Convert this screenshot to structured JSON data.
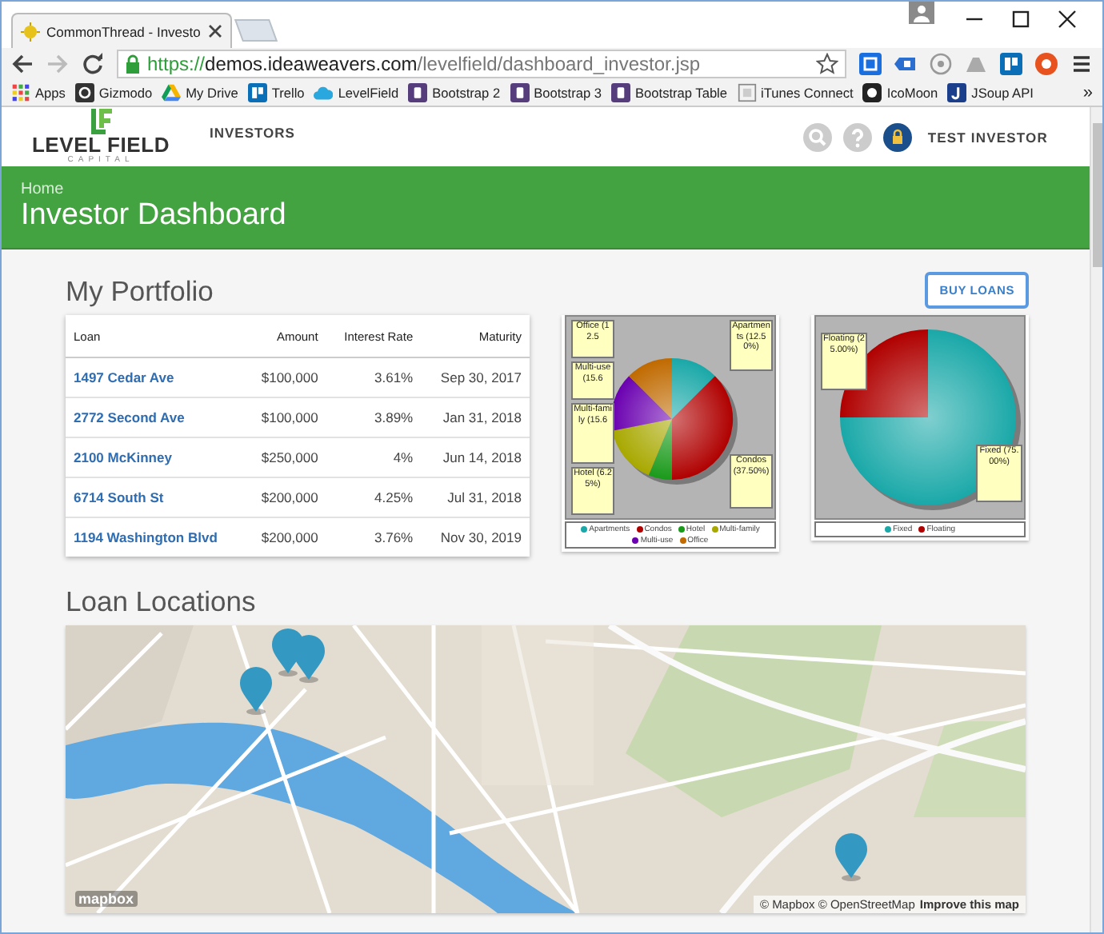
{
  "browser": {
    "tab_title": "CommonThread - Investo",
    "url": {
      "scheme": "https://",
      "host": "demos.ideaweavers.com",
      "path": "/levelfield/dashboard_investor.jsp"
    },
    "bookmarks": [
      {
        "label": "Apps"
      },
      {
        "label": "Gizmodo"
      },
      {
        "label": "My Drive"
      },
      {
        "label": "Trello"
      },
      {
        "label": "LevelField"
      },
      {
        "label": "Bootstrap 2"
      },
      {
        "label": "Bootstrap 3"
      },
      {
        "label": "Bootstrap Table"
      },
      {
        "label": "iTunes Connect"
      },
      {
        "label": "IcoMoon"
      },
      {
        "label": "JSoup API"
      }
    ],
    "more": "»"
  },
  "header": {
    "logo": {
      "name": "LEVEL FIELD",
      "sub": "CAPITAL"
    },
    "nav": [
      {
        "label": "INVESTORS"
      }
    ],
    "user": "TEST INVESTOR"
  },
  "banner": {
    "breadcrumb": "Home",
    "title": "Investor Dashboard"
  },
  "portfolio": {
    "title": "My Portfolio",
    "button": "BUY LOANS",
    "table": {
      "columns": [
        "Loan",
        "Amount",
        "Interest Rate",
        "Maturity"
      ],
      "rows": [
        [
          "1497 Cedar Ave",
          "$100,000",
          "3.61%",
          "Sep 30, 2017"
        ],
        [
          "2772 Second Ave",
          "$100,000",
          "3.89%",
          "Jan 31, 2018"
        ],
        [
          "2100 McKinney",
          "$250,000",
          "4%",
          "Jun 14, 2018"
        ],
        [
          "6714 South St",
          "$200,000",
          "4.25%",
          "Jul 31, 2018"
        ],
        [
          "1194 Washington Blvd",
          "$200,000",
          "3.76%",
          "Nov 30, 2019"
        ]
      ]
    },
    "charts": [
      {
        "chart_data": {
          "type": "pie",
          "categories": [
            "Apartments",
            "Condos",
            "Hotel",
            "Multi-family",
            "Multi-use",
            "Office"
          ],
          "colors": [
            "#1aa8a8",
            "#b00000",
            "#1a9a1a",
            "#a8a800",
            "#6a00b0",
            "#c06a00"
          ],
          "values": [
            12.5,
            37.5,
            6.25,
            15.6,
            15.6,
            12.5
          ],
          "annotations": [
            "Apartments (12.50%)",
            "Condos (37.50%)",
            "Hotel (6.25%)",
            "Office (12.5",
            "Multi-use (15.6",
            "Multi-family (15.6"
          ],
          "legend": "bottom"
        }
      },
      {
        "chart_data": {
          "type": "pie",
          "categories": [
            "Fixed",
            "Floating"
          ],
          "colors": [
            "#1aa8a8",
            "#b00000"
          ],
          "values": [
            75,
            25
          ],
          "annotations": [
            "Fixed (75.00%)",
            "Floating (25.00%)"
          ],
          "legend": "bottom"
        }
      }
    ]
  },
  "locations": {
    "title": "Loan Locations",
    "map": {
      "kind": "picture",
      "logo": "mapbox",
      "attribution": "© Mapbox © OpenStreetMap",
      "improve_link": "Improve this map"
    }
  }
}
